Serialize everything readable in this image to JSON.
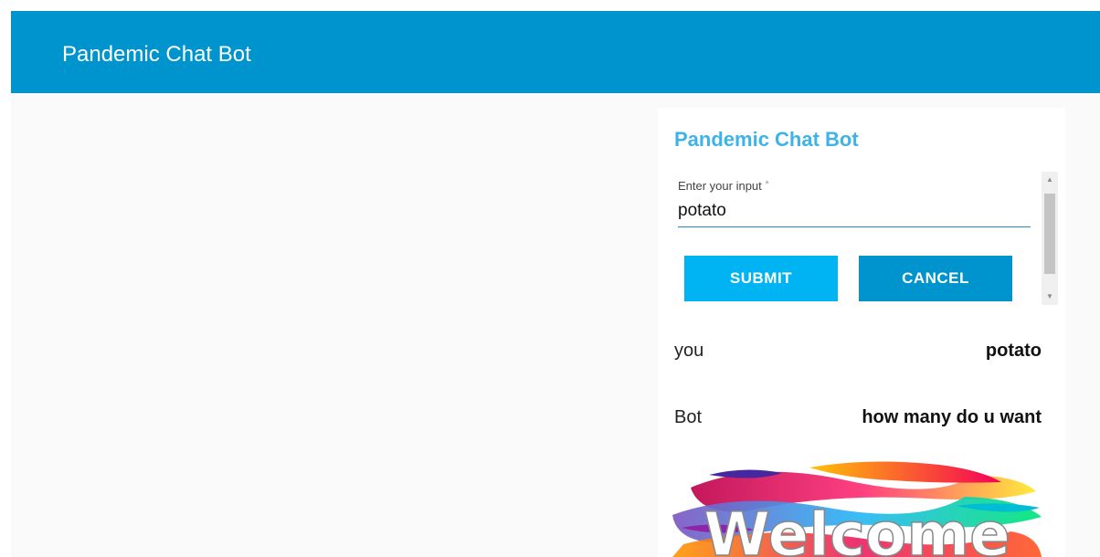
{
  "header": {
    "title": "Pandemic Chat Bot"
  },
  "chat": {
    "title": "Pandemic Chat Bot",
    "input": {
      "label": "Enter your input",
      "required_mark": "*",
      "value": "potato"
    },
    "buttons": {
      "submit": "SUBMIT",
      "cancel": "CANCEL"
    },
    "messages": [
      {
        "sender": "you",
        "text": "potato"
      },
      {
        "sender": "Bot",
        "text": "how many do u want"
      }
    ],
    "image": {
      "text": "Welcome"
    }
  },
  "colors": {
    "header_bg": "#0094ce",
    "title_accent": "#3eb3e8",
    "submit_bg": "#00b3f2",
    "cancel_bg": "#0094ce"
  },
  "icons": {
    "scroll_up": "scroll-up-arrow-icon",
    "scroll_down": "scroll-down-arrow-icon"
  }
}
